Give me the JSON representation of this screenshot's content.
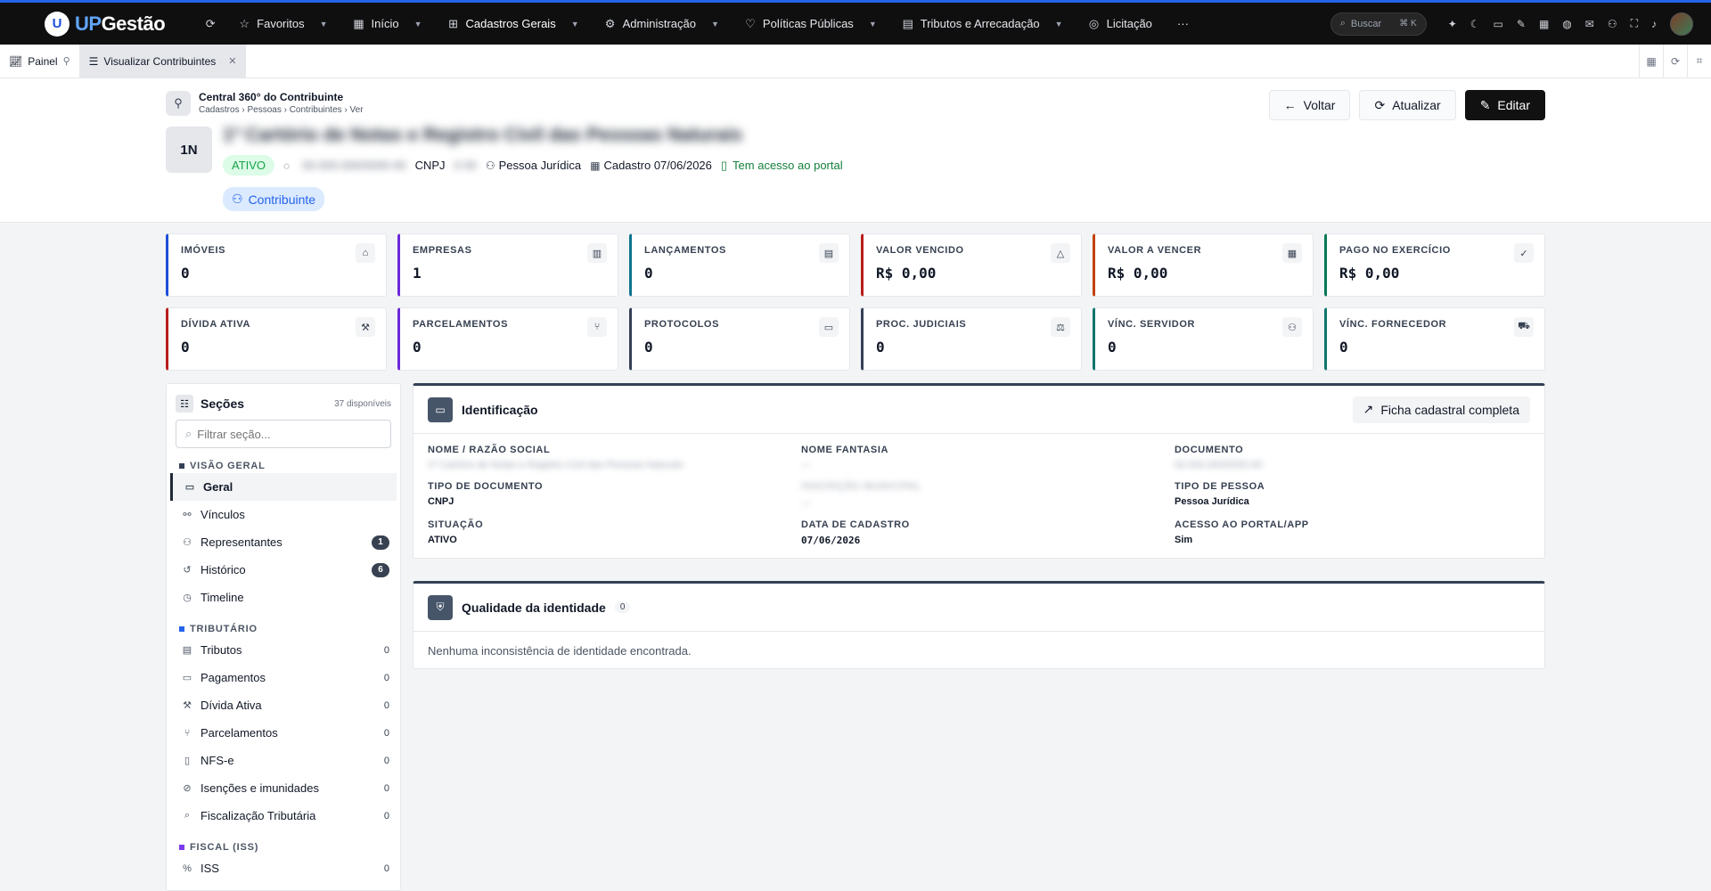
{
  "app": {
    "logo_up": "UP",
    "logo_rest": "Gestão",
    "logo_mark": "U",
    "nav": [
      {
        "label": "Favoritos",
        "icon": "star-icon"
      },
      {
        "label": "Início",
        "icon": "grid-icon"
      },
      {
        "label": "Cadastros Gerais",
        "icon": "tree-icon"
      },
      {
        "label": "Administração",
        "icon": "gear-icon"
      },
      {
        "label": "Políticas Públicas",
        "icon": "heart-icon"
      },
      {
        "label": "Tributos e Arrecadação",
        "icon": "receipt-icon"
      },
      {
        "label": "Licitação",
        "icon": "target-icon"
      },
      {
        "label": "···",
        "icon": "more-icon"
      }
    ],
    "search_label": "Buscar",
    "search_kbd": "⌘ K"
  },
  "tabs": [
    {
      "label": "Painel"
    },
    {
      "label": "Visualizar Contribuintes"
    }
  ],
  "header": {
    "section_title": "Central 360° do Contribuinte",
    "breadcrumb": "Cadastros › Pessoas › Contribuintes › Ver",
    "initials": "1N",
    "name": "1º Cartório de Notas e Registro Civil das Pessoas Naturais",
    "status": "ATIVO",
    "document_blurred": "00.000.000/0000-00",
    "document_type": "CNPJ",
    "extra_blurred": "0 00",
    "person_type": "Pessoa Jurídica",
    "cadastro": "Cadastro 07/06/2026",
    "portal": "Tem acesso ao portal",
    "role": "Contribuinte",
    "actions": {
      "back": "Voltar",
      "refresh": "Atualizar",
      "edit": "Editar"
    }
  },
  "kpis": [
    {
      "label": "IMÓVEIS",
      "value": "0",
      "color": "#1d4ed8",
      "icon": "house-icon"
    },
    {
      "label": "EMPRESAS",
      "value": "1",
      "color": "#6d28d9",
      "icon": "building-icon"
    },
    {
      "label": "LANÇAMENTOS",
      "value": "0",
      "color": "#0e7490",
      "icon": "document-icon"
    },
    {
      "label": "VALOR VENCIDO",
      "value": "R$ 0,00",
      "color": "#b91c1c",
      "icon": "warning-icon"
    },
    {
      "label": "VALOR A VENCER",
      "value": "R$ 0,00",
      "color": "#c2410c",
      "icon": "calendar-icon"
    },
    {
      "label": "PAGO NO EXERCÍCIO",
      "value": "R$ 0,00",
      "color": "#047857",
      "icon": "check-circle-icon"
    },
    {
      "label": "DÍVIDA ATIVA",
      "value": "0",
      "color": "#b91c1c",
      "icon": "gavel-icon"
    },
    {
      "label": "PARCELAMENTOS",
      "value": "0",
      "color": "#6d28d9",
      "icon": "split-icon"
    },
    {
      "label": "PROTOCOLOS",
      "value": "0",
      "color": "#334155",
      "icon": "inbox-icon"
    },
    {
      "label": "PROC. JUDICIAIS",
      "value": "0",
      "color": "#334155",
      "icon": "scales-icon"
    },
    {
      "label": "VÍNC. SERVIDOR",
      "value": "0",
      "color": "#0f766e",
      "icon": "users-icon"
    },
    {
      "label": "VÍNC. FORNECEDOR",
      "value": "0",
      "color": "#0f766e",
      "icon": "cart-icon"
    }
  ],
  "sidebar": {
    "title": "Seções",
    "available": "37 disponíveis",
    "filter_placeholder": "Filtrar seção...",
    "groups": [
      {
        "label": "VISÃO GERAL",
        "color": "#334155",
        "items": [
          {
            "label": "Geral",
            "icon": "id-card-icon",
            "count": "",
            "pill": false,
            "active": true
          },
          {
            "label": "Vínculos",
            "icon": "network-icon",
            "count": "",
            "pill": false,
            "active": false
          },
          {
            "label": "Representantes",
            "icon": "user-check-icon",
            "count": "1",
            "pill": true,
            "active": false
          },
          {
            "label": "Histórico",
            "icon": "history-icon",
            "count": "6",
            "pill": true,
            "active": false
          },
          {
            "label": "Timeline",
            "icon": "clock-icon",
            "count": "",
            "pill": false,
            "active": false
          }
        ]
      },
      {
        "label": "TRIBUTÁRIO",
        "color": "#2563eb",
        "items": [
          {
            "label": "Tributos",
            "icon": "receipt-icon",
            "count": "0",
            "pill": false,
            "active": false
          },
          {
            "label": "Pagamentos",
            "icon": "cash-icon",
            "count": "0",
            "pill": false,
            "active": false
          },
          {
            "label": "Dívida Ativa",
            "icon": "gavel-icon",
            "count": "0",
            "pill": false,
            "active": false
          },
          {
            "label": "Parcelamentos",
            "icon": "split-icon",
            "count": "0",
            "pill": false,
            "active": false
          },
          {
            "label": "NFS-e",
            "icon": "file-icon",
            "count": "0",
            "pill": false,
            "active": false
          },
          {
            "label": "Isenções e imunidades",
            "icon": "ban-icon",
            "count": "0",
            "pill": false,
            "active": false
          },
          {
            "label": "Fiscalização Tributária",
            "icon": "search-icon",
            "count": "0",
            "pill": false,
            "active": false
          }
        ]
      },
      {
        "label": "FISCAL (ISS)",
        "color": "#7c3aed",
        "items": [
          {
            "label": "ISS",
            "icon": "percent-icon",
            "count": "0",
            "pill": false,
            "active": false
          }
        ]
      }
    ]
  },
  "identification": {
    "title": "Identificação",
    "button": "Ficha cadastral completa",
    "fields": [
      {
        "label": "NOME / RAZÃO SOCIAL",
        "value": "1º Cartório de Notas e Registro Civil das Pessoas Naturais",
        "blur": true,
        "mono": false
      },
      {
        "label": "NOME FANTASIA",
        "value": "—",
        "blur": true,
        "mono": false
      },
      {
        "label": "DOCUMENTO",
        "value": "00.000.000/0000-00",
        "blur": true,
        "mono": false
      },
      {
        "label": "TIPO DE DOCUMENTO",
        "value": "CNPJ",
        "blur": false,
        "mono": false
      },
      {
        "label": "INSCRIÇÃO MUNICIPAL",
        "value": "—",
        "blur": true,
        "blur_label": true,
        "mono": false
      },
      {
        "label": "TIPO DE PESSOA",
        "value": "Pessoa Jurídica",
        "blur": false,
        "mono": false
      },
      {
        "label": "SITUAÇÃO",
        "value": "ATIVO",
        "blur": false,
        "mono": false
      },
      {
        "label": "DATA DE CADASTRO",
        "value": "07/06/2026",
        "blur": false,
        "mono": true
      },
      {
        "label": "ACESSO AO PORTAL/APP",
        "value": "Sim",
        "blur": false,
        "mono": false
      }
    ]
  },
  "quality": {
    "title": "Qualidade da identidade",
    "count": "0",
    "message": "Nenhuma inconsistência de identidade encontrada."
  }
}
